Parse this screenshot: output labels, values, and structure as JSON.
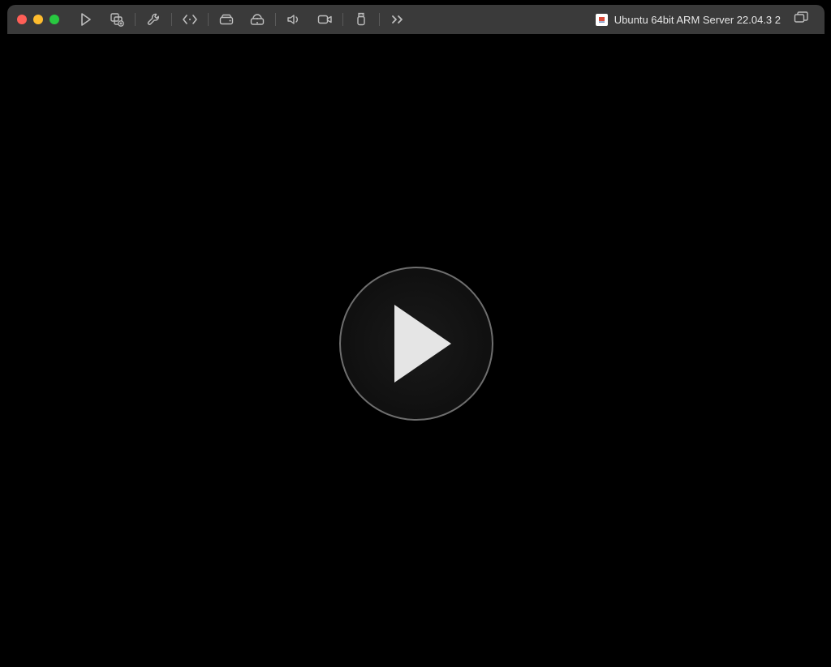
{
  "window": {
    "title": "Ubuntu 64bit ARM Server 22.04.3 2"
  },
  "toolbar": {
    "play_label": "Run",
    "snapshot_label": "Snapshot",
    "settings_label": "Settings",
    "code_label": "Developer",
    "hdd_label": "Disk",
    "optical_label": "Optical Drive",
    "sound_label": "Sound",
    "camera_label": "Camera",
    "usb_label": "USB",
    "overflow_label": ">>"
  },
  "icons": {
    "play": "play-icon",
    "snapshot": "snapshot-icon",
    "wrench": "wrench-icon",
    "code": "code-icon",
    "hdd": "hdd-icon",
    "optical": "optical-drive-icon",
    "sound": "sound-icon",
    "camera": "camera-icon",
    "usb": "usb-icon",
    "chevrons": "overflow-icon",
    "vm": "vm-file-icon",
    "duplicate": "windows-icon"
  },
  "main": {
    "play_button_label": "Start Virtual Machine"
  }
}
